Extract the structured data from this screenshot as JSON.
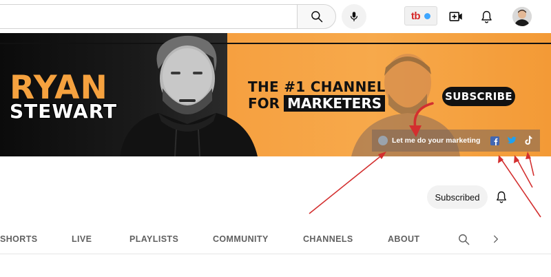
{
  "topbar": {
    "search_placeholder": "",
    "extension_label": "tb",
    "icons": {
      "search": "search-icon",
      "mic": "microphone-icon",
      "create": "video-camera-plus-icon",
      "notifications": "bell-icon",
      "avatar": "user-avatar"
    }
  },
  "banner": {
    "name_line1": "RYAN",
    "name_line2": "STEWART",
    "tagline_line1": "THE #1 CHANNEL",
    "tagline_line2_prefix": "FOR",
    "tagline_line2_highlight": "MARKETERS",
    "subscribe_art": "SUBSCRIBE",
    "link_text": "Let me do your marketing",
    "social_icons": [
      "facebook-icon",
      "twitter-icon",
      "tiktok-icon"
    ],
    "colors": {
      "brand_orange": "#f6a23f",
      "dark": "#111111",
      "annotation_red": "#d32f2f"
    }
  },
  "channel": {
    "subscribed_label": "Subscribed"
  },
  "tabs": {
    "items": [
      "SHORTS",
      "LIVE",
      "PLAYLISTS",
      "COMMUNITY",
      "CHANNELS",
      "ABOUT"
    ]
  }
}
